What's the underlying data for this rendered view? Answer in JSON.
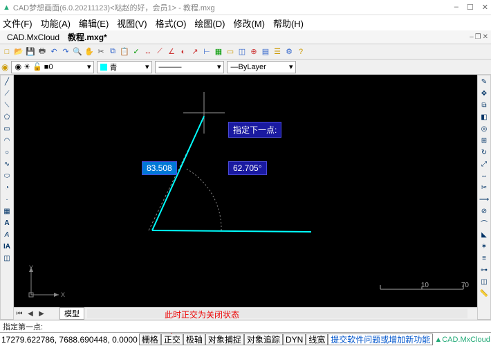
{
  "window": {
    "title": "CAD梦想画面(6.0.20211123)<哒赵的好，会员1> - 教程.mxg",
    "min": "–",
    "max": "☐",
    "close": "✕"
  },
  "menu": {
    "file": "文件(F)",
    "func": "功能(A)",
    "edit": "编辑(E)",
    "view": "视图(V)",
    "format": "格式(O)",
    "draw": "绘图(D)",
    "modify": "修改(M)",
    "help": "帮助(H)"
  },
  "tabs": {
    "cloud": "CAD.MxCloud",
    "doc": "教程.mxg*"
  },
  "layer": {
    "current": "0",
    "color_name": "青",
    "linetype": "ByLayer"
  },
  "canvas": {
    "prompt_label": "指定下一点:",
    "length_value": "83.508",
    "angle_value": "62.705°",
    "ruler_10": "10",
    "ruler_70": "70",
    "axis_x": "X",
    "axis_y": "Y"
  },
  "model_tab": "模型",
  "annotation": {
    "red_text": "此时正交为关闭状态"
  },
  "command": {
    "prompt": "指定第一点:"
  },
  "status": {
    "coords": "17279.622786,  7688.690448,  0.0000",
    "grid": "栅格",
    "ortho": "正交",
    "polar": "极轴",
    "osnap": "对象捕捉",
    "otrack": "对象追踪",
    "dyn": "DYN",
    "lwt": "线宽",
    "feedback": "提交软件问题或增加新功能",
    "brand": "CAD.MxCloud"
  }
}
